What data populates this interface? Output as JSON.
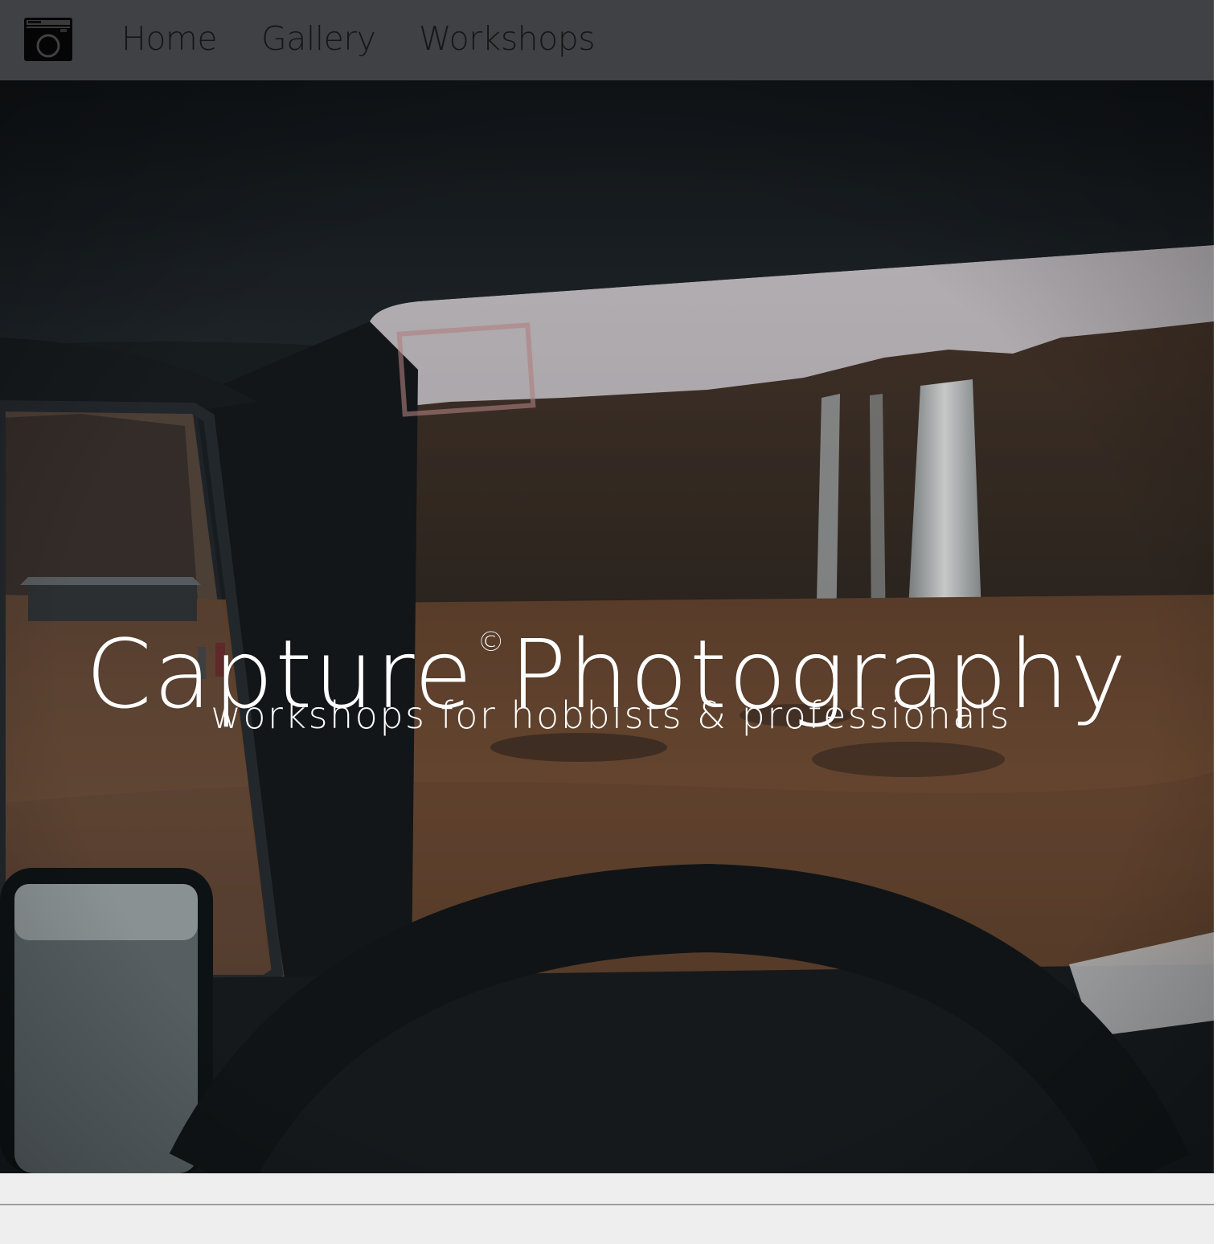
{
  "nav": {
    "logo_icon": "camera-icon",
    "items": [
      {
        "label": "Home"
      },
      {
        "label": "Gallery"
      },
      {
        "label": "Workshops"
      }
    ],
    "background": "#3f4145",
    "text_color": "#161616"
  },
  "hero": {
    "title_part1": "Capture",
    "title_mark": "©",
    "title_part2": "Photography",
    "subtitle": "workshops for hobbists & professionals",
    "text_color": "#ffffff"
  },
  "footer": {
    "background": "#eeeeee"
  }
}
